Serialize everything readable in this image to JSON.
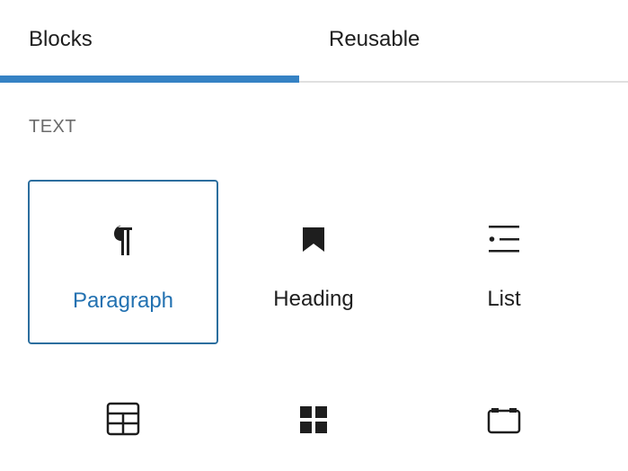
{
  "tabs": {
    "blocks_label": "Blocks",
    "reusable_label": "Reusable",
    "active": "Blocks"
  },
  "section": {
    "title": "TEXT"
  },
  "blocks": [
    {
      "label": "Paragraph",
      "icon": "paragraph-icon",
      "selected": true
    },
    {
      "label": "Heading",
      "icon": "bookmark-heading-icon",
      "selected": false
    },
    {
      "label": "List",
      "icon": "list-icon",
      "selected": false
    }
  ],
  "row2_icons": [
    "table-icon",
    "grid-blocks-icon",
    "calendar-icon"
  ],
  "colors": {
    "accent": "#3582c4",
    "selected_text": "#2271b1",
    "selected_border": "#2c6e9e",
    "muted_text": "#6b6b6b",
    "divider": "#e0e0e0",
    "text": "#1e1e1e"
  }
}
